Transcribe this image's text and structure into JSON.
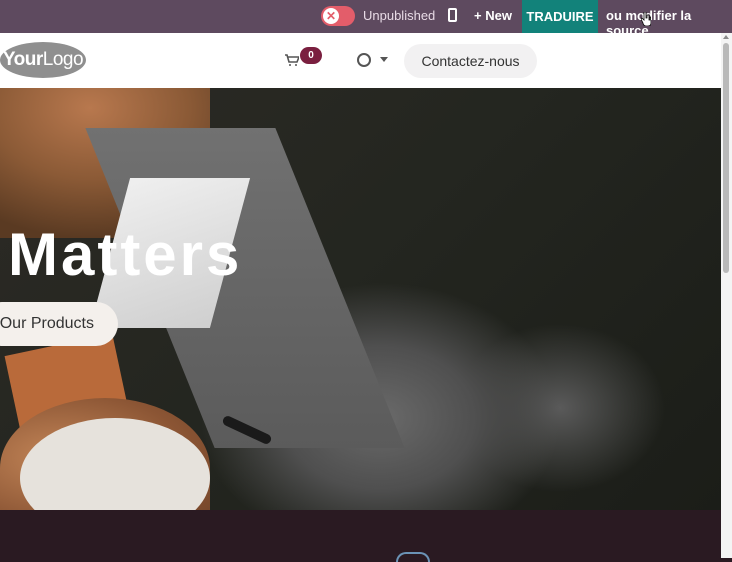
{
  "topbar": {
    "publish_toggle_icon": "x-icon",
    "publish_status": "Unpublished",
    "mobile_preview_icon": "mobile-phone-icon",
    "new_label": "New",
    "translate_label": "TRADUIRE",
    "edit_source_label": "ou modifier la source"
  },
  "header": {
    "logo_text_bold": "Your",
    "logo_text_regular": "Logo",
    "cart_icon": "shopping-cart-icon",
    "cart_count": "0",
    "user_icon": "user-circle-icon",
    "dropdown_icon": "caret-down-icon",
    "contact_label": "Contactez-nous"
  },
  "hero": {
    "title": "Matters",
    "cta_label": "Our Products"
  },
  "colors": {
    "topbar_bg": "#5e4a5f",
    "translate_bg": "#12827a",
    "badge_bg": "#7a1f3f",
    "toggle_red": "#e35d6a",
    "footer_bg": "#2a1a22"
  }
}
